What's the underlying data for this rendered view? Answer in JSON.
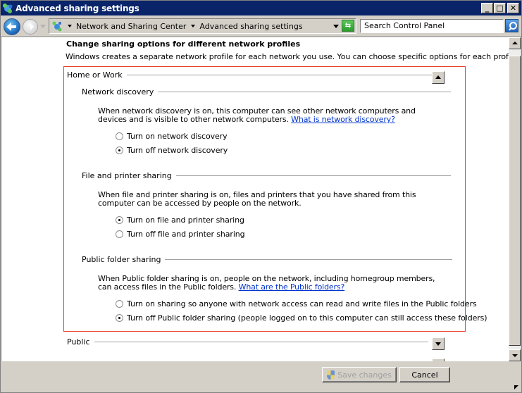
{
  "window": {
    "title": "Advanced sharing settings",
    "controls": {
      "minimize": "_",
      "maximize": "□",
      "close": "✕"
    }
  },
  "navbar": {
    "breadcrumbs": [
      "Network and Sharing Center",
      "Advanced sharing settings"
    ],
    "search_placeholder": "Search Control Panel",
    "refresh_glyph": "⇆"
  },
  "content": {
    "heading": "Change sharing options for different network profiles",
    "intro": "Windows creates a separate network profile for each network you use. You can choose specific options for each profile.",
    "profiles": [
      {
        "name": "Home or Work",
        "expanded": true,
        "sections": [
          {
            "title": "Network discovery",
            "description": "When network discovery is on, this computer can see other network computers and devices and is visible to other network computers.",
            "link": "What is network discovery?",
            "options": [
              {
                "label": "Turn on network discovery",
                "checked": false
              },
              {
                "label": "Turn off network discovery",
                "checked": true
              }
            ]
          },
          {
            "title": "File and printer sharing",
            "description": "When file and printer sharing is on, files and printers that you have shared from this computer can be accessed by people on the network.",
            "link": "",
            "options": [
              {
                "label": "Turn on file and printer sharing",
                "checked": true
              },
              {
                "label": "Turn off file and printer sharing",
                "checked": false
              }
            ]
          },
          {
            "title": "Public folder sharing",
            "description": "When Public folder sharing is on, people on the network, including homegroup members, can access files in the Public folders.",
            "link": "What are the Public folders?",
            "options": [
              {
                "label": "Turn on sharing so anyone with network access can read and write files in the Public folders",
                "checked": false
              },
              {
                "label": "Turn off Public folder sharing (people logged on to this computer can still access these folders)",
                "checked": true
              }
            ]
          }
        ]
      },
      {
        "name": "Public",
        "expanded": false
      }
    ]
  },
  "footer": {
    "save_label": "Save changes",
    "save_enabled": false,
    "cancel_label": "Cancel"
  },
  "colors": {
    "titlebar": "#0a246a",
    "highlight_border": "#e8412a",
    "link": "#0033cc"
  }
}
